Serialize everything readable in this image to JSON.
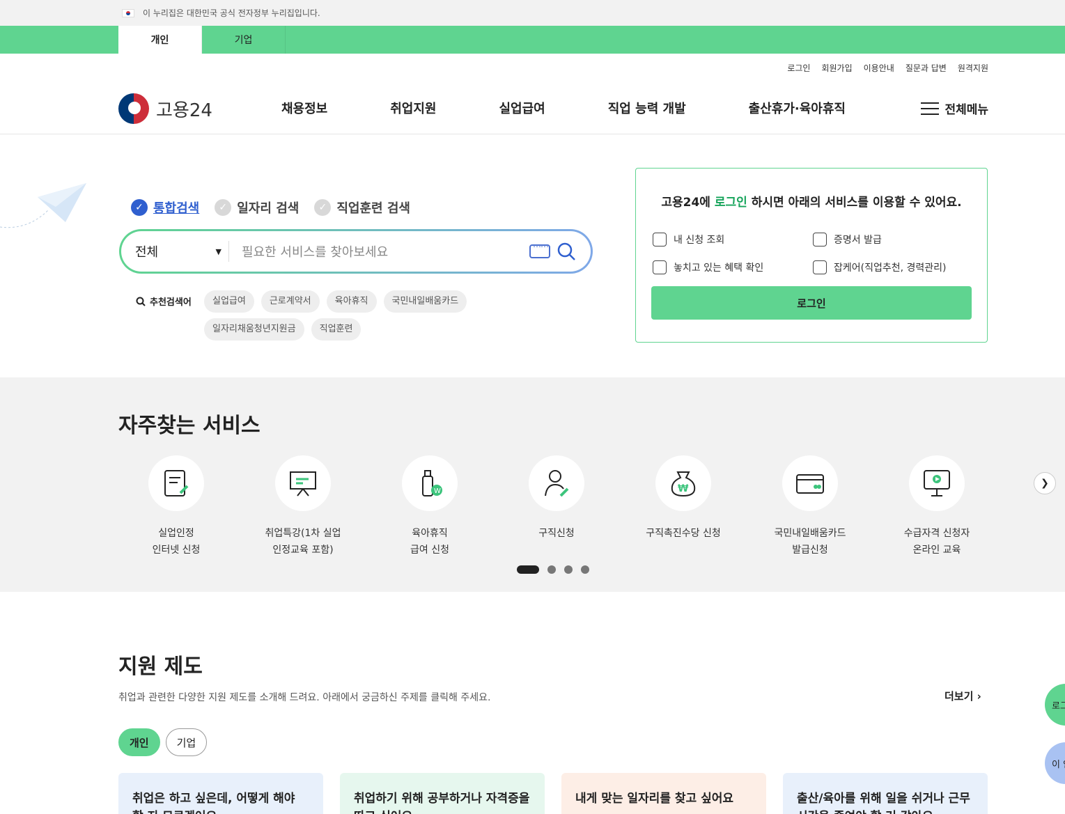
{
  "gov_notice": "이 누리집은 대한민국 공식 전자정부 누리집입니다.",
  "user_tabs": [
    {
      "label": "개인"
    },
    {
      "label": "기업"
    }
  ],
  "util_links": [
    "로그인",
    "회원가입",
    "이용안내",
    "질문과 답변",
    "원격지원"
  ],
  "logo_text": "고용24",
  "gnb": [
    "채용정보",
    "취업지원",
    "실업급여",
    "직업 능력 개발",
    "출산휴가·육아휴직"
  ],
  "all_menu": "전체메뉴",
  "search": {
    "tabs": [
      "통합검색",
      "일자리 검색",
      "직업훈련 검색"
    ],
    "select_value": "전체",
    "placeholder": "필요한 서비스를 찾아보세요",
    "rec_label": "추천검색어",
    "keywords": [
      "실업급여",
      "근로계약서",
      "육아휴직",
      "국민내일배움카드",
      "일자리채움청년지원금",
      "직업훈련"
    ]
  },
  "login_card": {
    "title_pre": "고용24에 ",
    "title_hl": "로그인",
    "title_post": " 하시면 아래의 서비스를 이용할 수 있어요.",
    "items": [
      "내 신청 조회",
      "증명서 발급",
      "놓치고 있는 혜택 확인",
      "잡케어(직업추천, 경력관리)"
    ],
    "button": "로그인"
  },
  "frequent": {
    "title": "자주찾는 서비스",
    "services": [
      {
        "l1": "실업인정",
        "l2": "인터넷 신청"
      },
      {
        "l1": "취업특강(1차 실업",
        "l2": "인정교육 포함)"
      },
      {
        "l1": "육아휴직",
        "l2": "급여 신청"
      },
      {
        "l1": "구직신청",
        "l2": ""
      },
      {
        "l1": "구직촉진수당 신청",
        "l2": ""
      },
      {
        "l1": "국민내일배움카드",
        "l2": "발급신청"
      },
      {
        "l1": "수급자격 신청자",
        "l2": "온라인 교육"
      }
    ]
  },
  "support": {
    "title": "지원 제도",
    "desc": "취업과 관련한 다양한 지원 제도를 소개해 드려요. 아래에서 궁금하신 주제를 클릭해 주세요.",
    "more": "더보기",
    "tabs": [
      "개인",
      "기업"
    ],
    "cards": [
      {
        "text": "취업은 하고 싶은데, 어떻게 해야 할 지 모르겠어요",
        "bg": "#e8f0fb"
      },
      {
        "text": "취업하기 위해 공부하거나 자격증을 따고 싶어요",
        "bg": "#e6f7ee"
      },
      {
        "text": "내게 맞는 일자리를 찾고 싶어요",
        "bg": "#fdeee6"
      },
      {
        "text": "출산/육아를 위해 일을 쉬거나 근무 시간을 줄여야 할 거 같아요",
        "bg": "#e8f0fb"
      }
    ]
  },
  "floating": {
    "login": "로그",
    "info": "이 안"
  },
  "colors": {
    "brand_green": "#5fd490",
    "accent_blue": "#2f5fcf"
  }
}
